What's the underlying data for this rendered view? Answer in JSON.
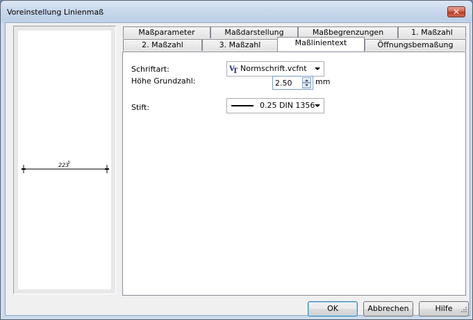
{
  "window": {
    "title": "Voreinstellung Linienmaß",
    "close_glyph": "✕"
  },
  "preview": {
    "dimension_text": "223"
  },
  "tabs": {
    "row1": [
      "Maßparameter",
      "Maßdarstellung",
      "Maßbegrenzungen",
      "1. Maßzahl"
    ],
    "row2": [
      "2. Maßzahl",
      "3. Maßzahl",
      "Maßlinientext",
      "Öffnungsbemaßung"
    ],
    "active": "Maßlinientext"
  },
  "form": {
    "font_label": "Schriftart:",
    "font_value": "Normschrift.vcfnt",
    "font_icon": "vectorfont-icon",
    "height_label": "Höhe Grundzahl:",
    "height_value": "2.50",
    "height_unit": "mm",
    "pen_label": "Stift:",
    "pen_value": "0.25 DIN 1356"
  },
  "buttons": {
    "ok": "OK",
    "cancel": "Abbrechen",
    "help": "Hilfe"
  },
  "colors": {
    "close_button": "#c9462c",
    "vt_icon": "#2a2f7a"
  }
}
